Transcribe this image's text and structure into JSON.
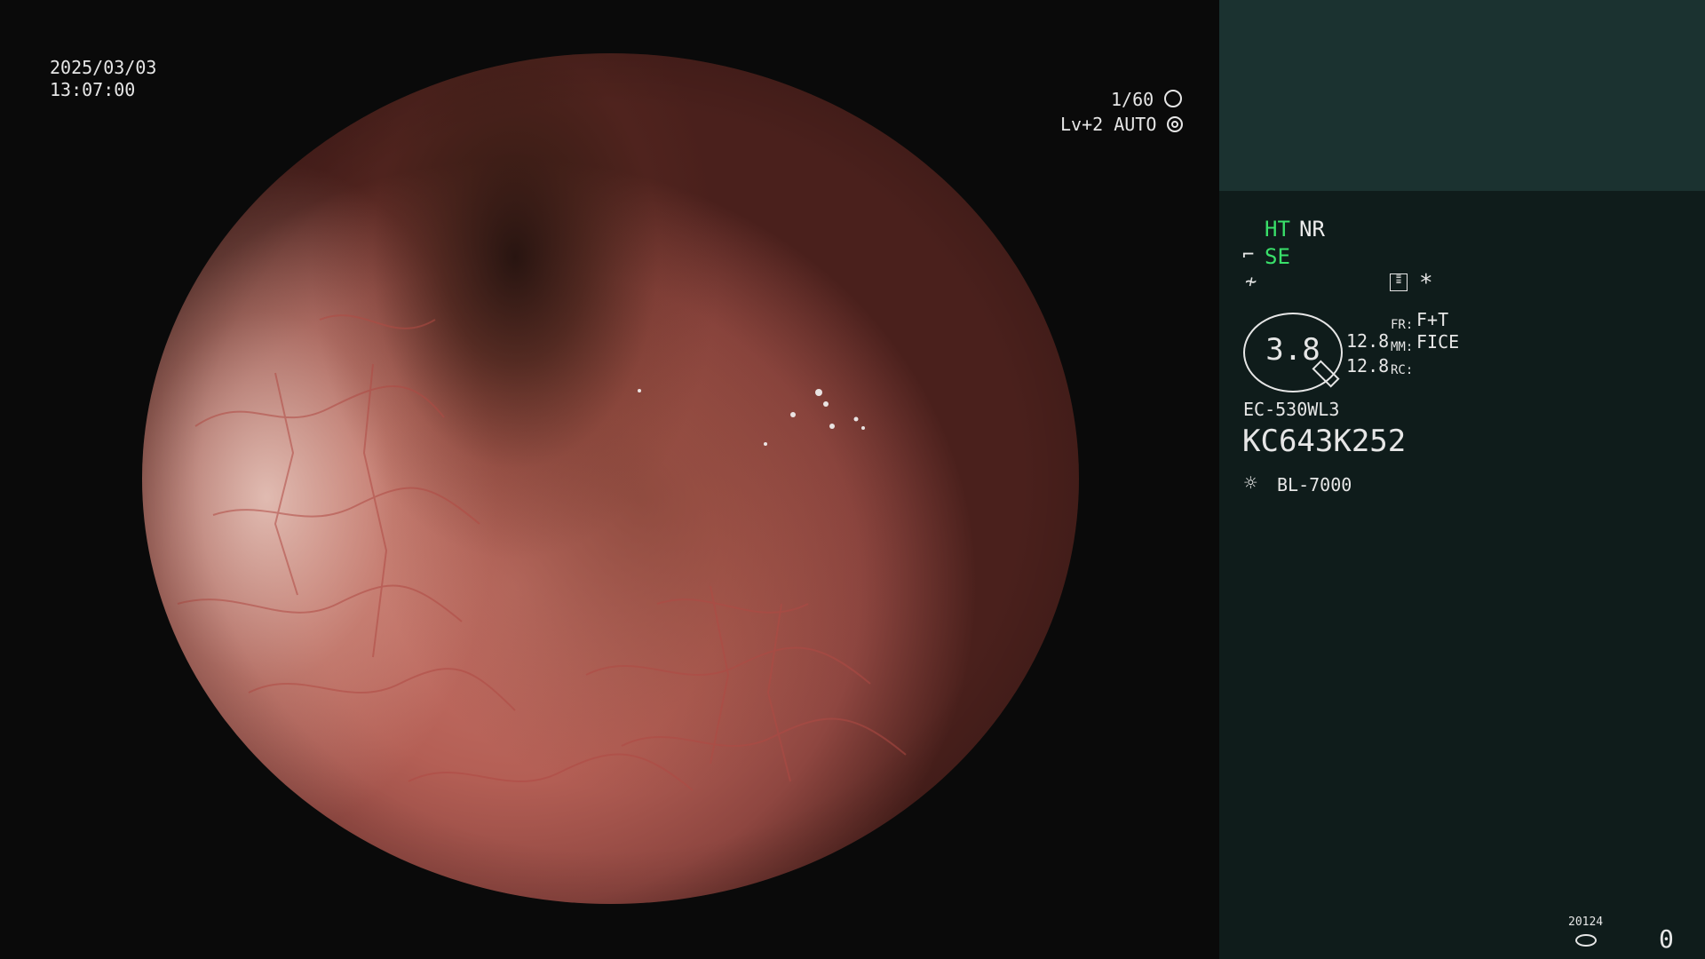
{
  "osd_left": {
    "date": "2025/03/03",
    "time": "13:07:00"
  },
  "osd_top_right": {
    "shutter": "1/60",
    "level": "Lv+2",
    "mode": "AUTO"
  },
  "panel": {
    "ht": "HT",
    "nr": "NR",
    "se": "SE",
    "star": "*",
    "magnification": "3.8",
    "values": [
      "12.8",
      "12.8"
    ],
    "fr_label": "FR:",
    "fr_value": "F+T",
    "mm_label": "MM:",
    "mm_value": "FICE",
    "rc_label": "RC:",
    "scope_model": "EC-530WL3",
    "serial": "KC643K252",
    "light_source": "BL-7000",
    "counter_small": "20124",
    "counter": "0"
  },
  "icons": {
    "shutter": "aperture-icon",
    "auto": "iris-icon",
    "se": "enhancement-curve-icon",
    "tone": "tone-curve-icon",
    "memory": "memory-list-icon",
    "light": "sun-icon",
    "disk": "disk-icon"
  },
  "colors": {
    "left_background": "#0a0a0a",
    "right_panel": "#0f1c1b",
    "right_top_box": "#1b3230",
    "accent_green": "#39e06a"
  }
}
